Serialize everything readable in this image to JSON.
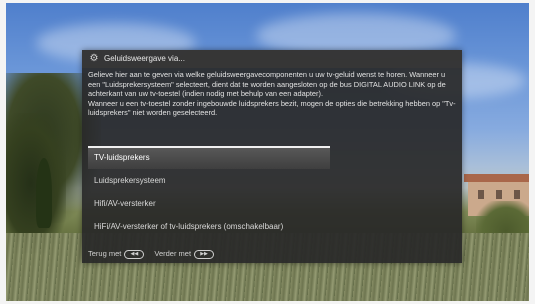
{
  "dialog": {
    "title": "Geluidsweergave via...",
    "title_icon": "settings-gears-icon",
    "paragraph1": "Gelieve hier aan te geven via welke geluidsweergavecomponenten u uw tv-geluid wenst te horen. Wanneer u een \"Luidsprekersysteem\" selecteert, dient dat te worden aangesloten op de bus DIGITAL AUDIO LINK op de achterkant van uw tv-toestel (indien nodig met behulp van een adapter).",
    "paragraph2": "Wanneer u een tv-toestel zonder ingebouwde luidsprekers bezit, mogen de opties die betrekking hebben op \"Tv-luidsprekers\" niet worden geselecteerd.",
    "options": [
      {
        "label": "TV-luidsprekers",
        "selected": true
      },
      {
        "label": "Luidsprekersysteem",
        "selected": false
      },
      {
        "label": "Hifi/AV-versterker",
        "selected": false
      },
      {
        "label": "HiFi/AV-versterker of tv-luidsprekers (omschakelbaar)",
        "selected": false
      }
    ],
    "footer": {
      "back_label": "Terug met",
      "back_icon": "rewind-button-icon",
      "next_label": "Verder met",
      "next_icon": "fast-forward-button-icon"
    }
  },
  "colors": {
    "dialog_bg": "#282828",
    "selected_bg": "#4a4a4a",
    "text": "#e2e2e2"
  }
}
